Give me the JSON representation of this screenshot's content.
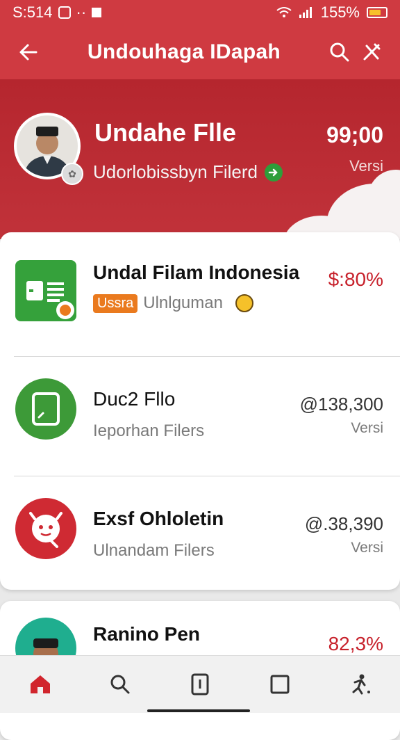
{
  "status": {
    "time": "S:514",
    "battery_pct": "155%"
  },
  "appbar": {
    "title": "Undouhaga IDapah"
  },
  "header": {
    "title": "Undahe Flle",
    "subtitle": "Udorlobissbyn Filerd",
    "value": "99;00",
    "version_label": "Versi"
  },
  "list": [
    {
      "title": "Undal Filam Indonesia",
      "tag": "Ussra",
      "sub": "Ulnlguman",
      "value": "$:80%"
    },
    {
      "title": "Duc2 Fllo",
      "sub": "Ieporhan Filers",
      "value": "@138,300",
      "version": "Versi"
    },
    {
      "title": "Exsf Ohloletin",
      "sub": "Ulnandam Filers",
      "value": "@.38,390",
      "version": "Versi"
    },
    {
      "title": "Ranino Pen",
      "value": "82,3%"
    }
  ],
  "colors": {
    "accent": "#cf3a41",
    "header_dark": "#b5262e",
    "green": "#2e9e3a",
    "orange": "#ea7a1e"
  },
  "nav": [
    "home-icon",
    "search-icon",
    "file-icon",
    "square-icon",
    "runner-icon"
  ]
}
